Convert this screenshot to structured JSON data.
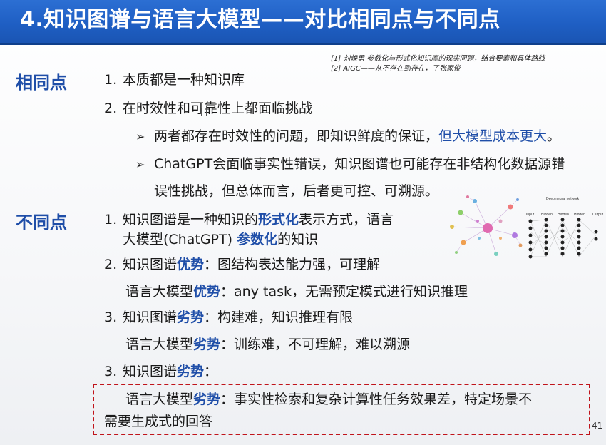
{
  "title": "4.知识图谱与语言大模型——对比相同点与不同点",
  "refs": [
    "[1] 刘焕勇 参数化与形式化知识库的现实问题，结合要素和具体路线",
    "[2] AIGC——从不存在到存在，了张家俊"
  ],
  "same": {
    "label": "相同点",
    "item1_num": "1.",
    "item1": "本质都是一种知识库",
    "item2_num": "2.",
    "item2": "在时效性和可靠性上都面临挑战",
    "bullet_arrow": "➢",
    "b1_text": "两者都存在时效性的问题，即知识鲜度的保证，",
    "b1_blue": "但大模型成本更大",
    "b1_end": "。",
    "b2_line1": "ChatGPT会面临事实性错误，知识图谱也可能存在非结构化数据源错",
    "b2_line2": "误性挑战，但总体而言，后者更可控、可溯源。"
  },
  "diff": {
    "label": "不同点",
    "i1_num": "1.",
    "i1_a": "知识图谱是一种知识的",
    "i1_b": "形式化",
    "i1_c": "表示方式，语言",
    "i1_d": "大模型(ChatGPT) ",
    "i1_e": "参数化",
    "i1_f": "的知识",
    "i2_num": "2.",
    "i2_a": "知识图谱",
    "i2_b": "优势",
    "i2_c": "：图结构表达能力强，可理解",
    "i2_d": "语言大模型",
    "i2_e": "优势",
    "i2_f": "：any task，无需预定模式进行知识推理",
    "i3_num": "3.",
    "i3_a": "知识图谱",
    "i3_b": "劣势",
    "i3_c": "：构建难，知识推理有限",
    "i3_d": "语言大模型",
    "i3_e": "劣势",
    "i3_f": "：训练难，不可理解，难以溯源",
    "i4_num": "3.",
    "i4_a": "知识图谱",
    "i4_b": "劣势",
    "i4_c": "：",
    "i4_d": "语言大模型",
    "i4_e": "劣势",
    "i4_f": "：事实性检索和复杂计算性任务效果差，特定场景不",
    "i4_g": "需要生成式的回答"
  },
  "figure": {
    "nn_title": "Deep neural network",
    "nn_labels": [
      "Input",
      "Hidden",
      "Hidden",
      "Hidden",
      "Output"
    ]
  },
  "page_number": "41",
  "colors": {
    "title_bar": "#1f5fc4",
    "accent": "#1f4ea8",
    "dash": "#c0141b"
  }
}
